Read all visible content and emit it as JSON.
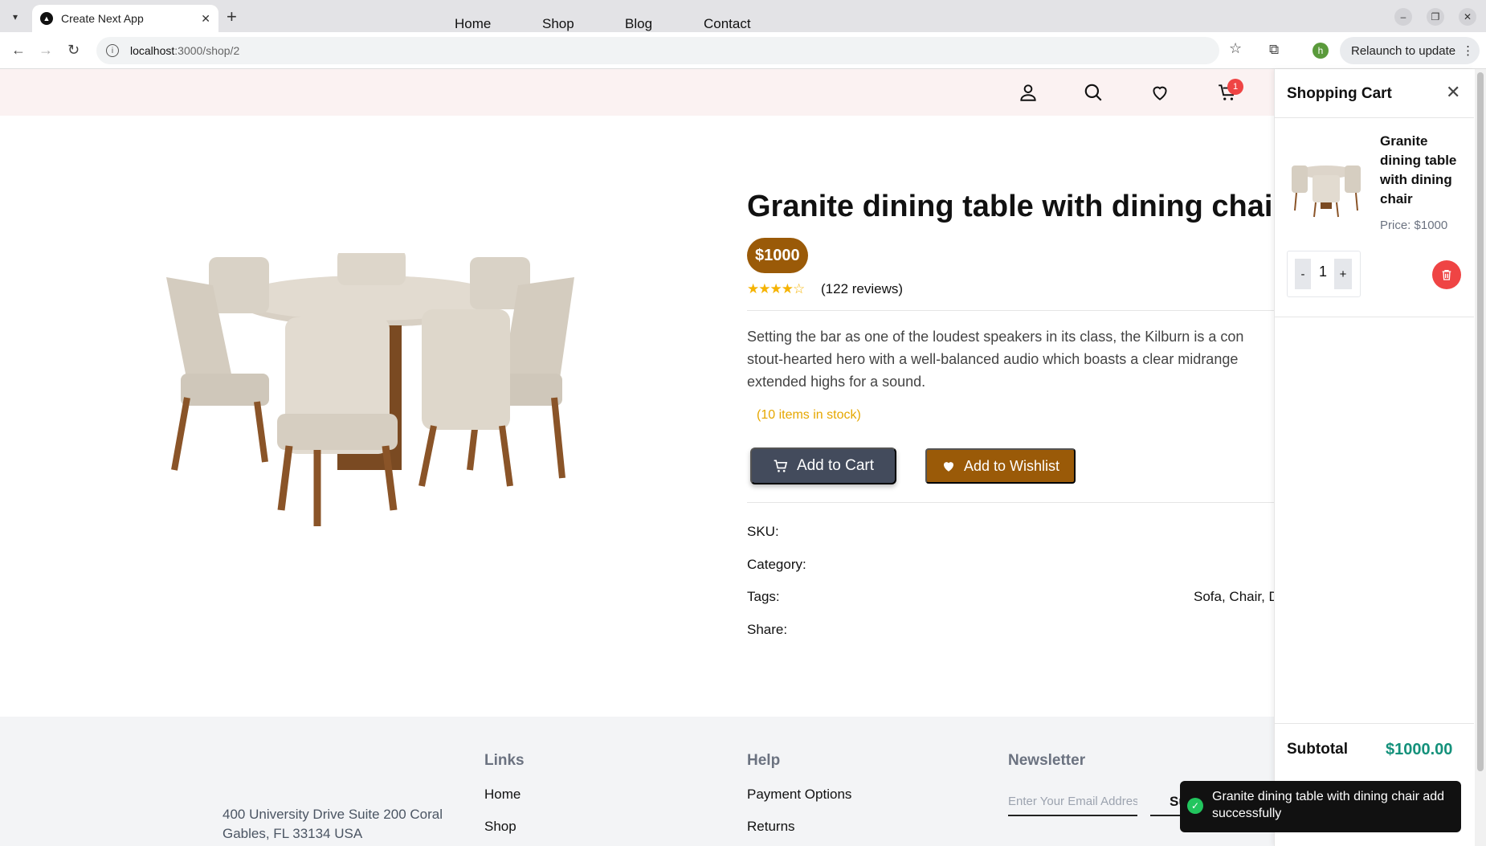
{
  "browser": {
    "tab_title": "Create Next App",
    "url_host": "localhost",
    "url_path": ":3000/shop/2",
    "relaunch_label": "Relaunch to update",
    "profile_initial": "h"
  },
  "nav": {
    "home": "Home",
    "shop": "Shop",
    "blog": "Blog",
    "contact": "Contact",
    "cart_count": "1"
  },
  "product": {
    "title": "Granite dining table with dining chair",
    "price": "$1000",
    "rating_stars": 4,
    "reviews": "(122 reviews)",
    "description_lines": [
      "Setting the bar as one of the loudest speakers in its class, the Kilburn is a con",
      "stout-hearted hero with a well-balanced audio which boasts a clear midrange",
      "extended highs for a sound."
    ],
    "stock": "(10 items in stock)",
    "add_to_cart": "Add to Cart",
    "add_to_wishlist": "Add to Wishlist",
    "sku_label": "SKU:",
    "category_label": "Category:",
    "tags_label": "Tags:",
    "tags_value": "Sofa, Chair, D",
    "share_label": "Share:"
  },
  "footer": {
    "address_line1": "400 University Drive Suite 200 Coral",
    "address_line2": "Gables, FL 33134 USA",
    "links_heading": "Links",
    "links": [
      "Home",
      "Shop"
    ],
    "help_heading": "Help",
    "help_links": [
      "Payment Options",
      "Returns"
    ],
    "newsletter_heading": "Newsletter",
    "newsletter_placeholder": "Enter Your Email Addres",
    "subscribe_label": "Subscribe"
  },
  "cart": {
    "title": "Shopping Cart",
    "item_name": "Granite dining table with dining chair",
    "item_price": "Price: $1000",
    "quantity": "1",
    "minus": "-",
    "plus": "+",
    "subtotal_label": "Subtotal",
    "subtotal_value": "$1000.00"
  },
  "toast": {
    "message": "Granite dining table with dining chair add successfully"
  },
  "colors": {
    "brand_brown": "#9a5a08",
    "cart_button": "#434b5c",
    "subtotal_green": "#14917b",
    "badge_red": "#ef4444"
  }
}
